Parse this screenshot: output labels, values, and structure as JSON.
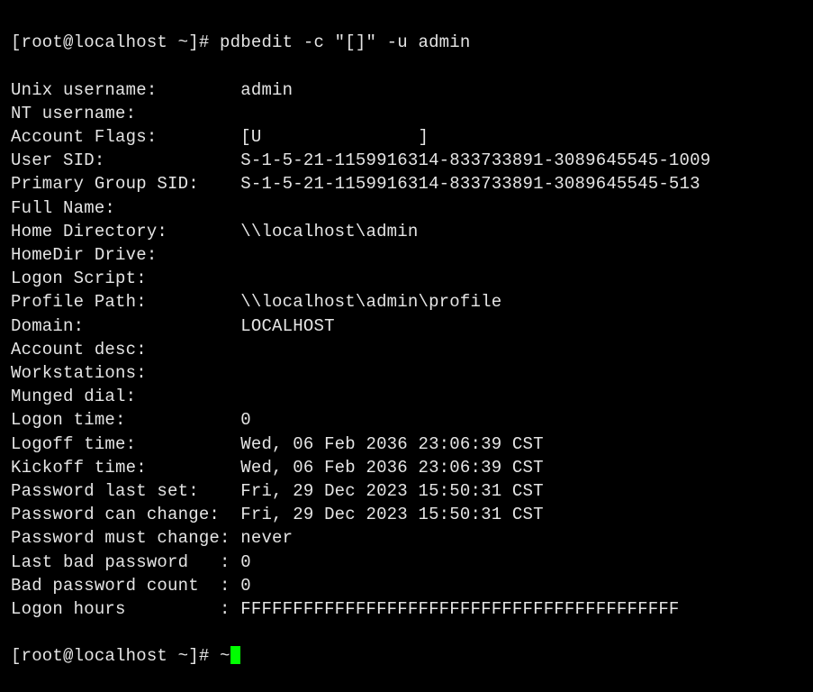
{
  "prompt1": {
    "user_host": "[root@localhost ~]# ",
    "command": "pdbedit -c \"[]\" -u admin"
  },
  "fields": [
    {
      "label": "Unix username:        ",
      "value": "admin"
    },
    {
      "label": "NT username:",
      "value": ""
    },
    {
      "label": "Account Flags:        ",
      "value": "[U               ]"
    },
    {
      "label": "User SID:             ",
      "value": "S-1-5-21-1159916314-833733891-3089645545-1009"
    },
    {
      "label": "Primary Group SID:    ",
      "value": "S-1-5-21-1159916314-833733891-3089645545-513"
    },
    {
      "label": "Full Name:",
      "value": ""
    },
    {
      "label": "Home Directory:       ",
      "value": "\\\\localhost\\admin"
    },
    {
      "label": "HomeDir Drive:",
      "value": ""
    },
    {
      "label": "Logon Script:",
      "value": ""
    },
    {
      "label": "Profile Path:         ",
      "value": "\\\\localhost\\admin\\profile"
    },
    {
      "label": "Domain:               ",
      "value": "LOCALHOST"
    },
    {
      "label": "Account desc:",
      "value": ""
    },
    {
      "label": "Workstations:",
      "value": ""
    },
    {
      "label": "Munged dial:",
      "value": ""
    },
    {
      "label": "Logon time:           ",
      "value": "0"
    },
    {
      "label": "Logoff time:          ",
      "value": "Wed, 06 Feb 2036 23:06:39 CST"
    },
    {
      "label": "Kickoff time:         ",
      "value": "Wed, 06 Feb 2036 23:06:39 CST"
    },
    {
      "label": "Password last set:    ",
      "value": "Fri, 29 Dec 2023 15:50:31 CST"
    },
    {
      "label": "Password can change:  ",
      "value": "Fri, 29 Dec 2023 15:50:31 CST"
    },
    {
      "label": "Password must change: ",
      "value": "never"
    },
    {
      "label": "Last bad password   : ",
      "value": "0"
    },
    {
      "label": "Bad password count  : ",
      "value": "0"
    },
    {
      "label": "Logon hours         : ",
      "value": "FFFFFFFFFFFFFFFFFFFFFFFFFFFFFFFFFFFFFFFFFF"
    }
  ],
  "prompt2": {
    "user_host": "[root@localhost ~]# ",
    "typed": "~"
  }
}
